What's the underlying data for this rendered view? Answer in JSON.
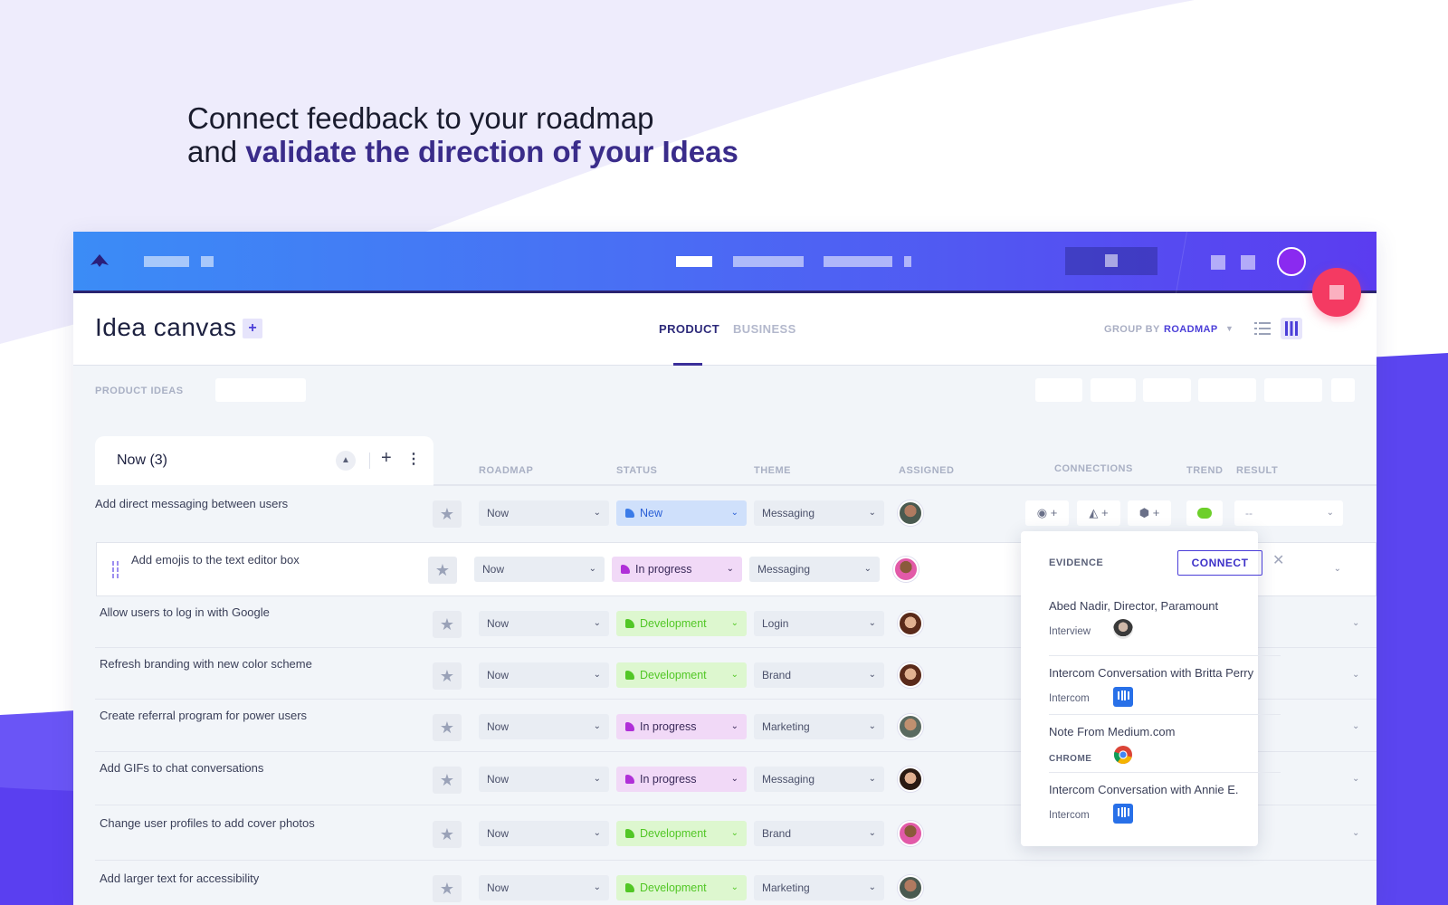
{
  "headline": {
    "line1": "Connect feedback to your roadmap",
    "line2_prefix": "and ",
    "line2_strong": "validate the direction of your Ideas"
  },
  "page": {
    "title": "Idea canvas",
    "add_label": "+",
    "tabs": [
      {
        "label": "PRODUCT",
        "active": true
      },
      {
        "label": "BUSINESS",
        "active": false
      }
    ],
    "group_by_label": "GROUP BY",
    "group_by_value": "ROADMAP",
    "filter_label": "PRODUCT IDEAS"
  },
  "group": {
    "title": "Now (3)",
    "collapse_icon": "chevron-up-icon",
    "add_label": "+",
    "menu_label": "⋮"
  },
  "columns": {
    "roadmap": "ROADMAP",
    "status": "STATUS",
    "theme": "THEME",
    "assigned": "ASSIGNED",
    "connections": "CONNECTIONS",
    "trend": "TREND",
    "result": "RESULT"
  },
  "rows": [
    {
      "title": "Add direct messaging between users",
      "roadmap": "Now",
      "status": "New",
      "theme": "Messaging"
    },
    {
      "title": "Add emojis to the text editor box",
      "roadmap": "Now",
      "status": "In progress",
      "theme": "Messaging"
    },
    {
      "title": "Allow users to log in with Google",
      "roadmap": "Now",
      "status": "Development",
      "theme": "Login"
    },
    {
      "title": "Refresh branding with new color scheme",
      "roadmap": "Now",
      "status": "Development",
      "theme": "Brand"
    },
    {
      "title": "Create referral program for power users",
      "roadmap": "Now",
      "status": "In progress",
      "theme": "Marketing"
    },
    {
      "title": "Add GIFs to chat conversations",
      "roadmap": "Now",
      "status": "In progress",
      "theme": "Messaging"
    },
    {
      "title": "Change user profiles to add cover photos",
      "roadmap": "Now",
      "status": "Development",
      "theme": "Brand"
    },
    {
      "title": "Add larger text for accessibility",
      "roadmap": "Now",
      "status": "Development",
      "theme": "Marketing"
    }
  ],
  "first_row_extras": {
    "connections": [
      "+",
      "+",
      "+"
    ],
    "result": "--"
  },
  "evidence": {
    "title": "EVIDENCE",
    "connect_label": "CONNECT",
    "close_label": "✕",
    "items": [
      {
        "name": "Abed Nadir, Director, Paramount",
        "source": "Interview",
        "icon": "person-avatar-icon"
      },
      {
        "name": "Intercom Conversation with Britta Perry",
        "source": "Intercom",
        "icon": "intercom-icon"
      },
      {
        "name": "Note From Medium.com",
        "source": "CHROME",
        "icon": "chrome-icon"
      },
      {
        "name": "Intercom Conversation with Annie E.",
        "source": "Intercom",
        "icon": "intercom-icon"
      }
    ]
  },
  "colors": {
    "accent": "#4b3ed8",
    "headline_strong": "#3a2c8a",
    "fab": "#f43a62",
    "status_new": "#2a5fd6",
    "status_in_progress": "#b030d8",
    "status_development": "#52c726"
  }
}
